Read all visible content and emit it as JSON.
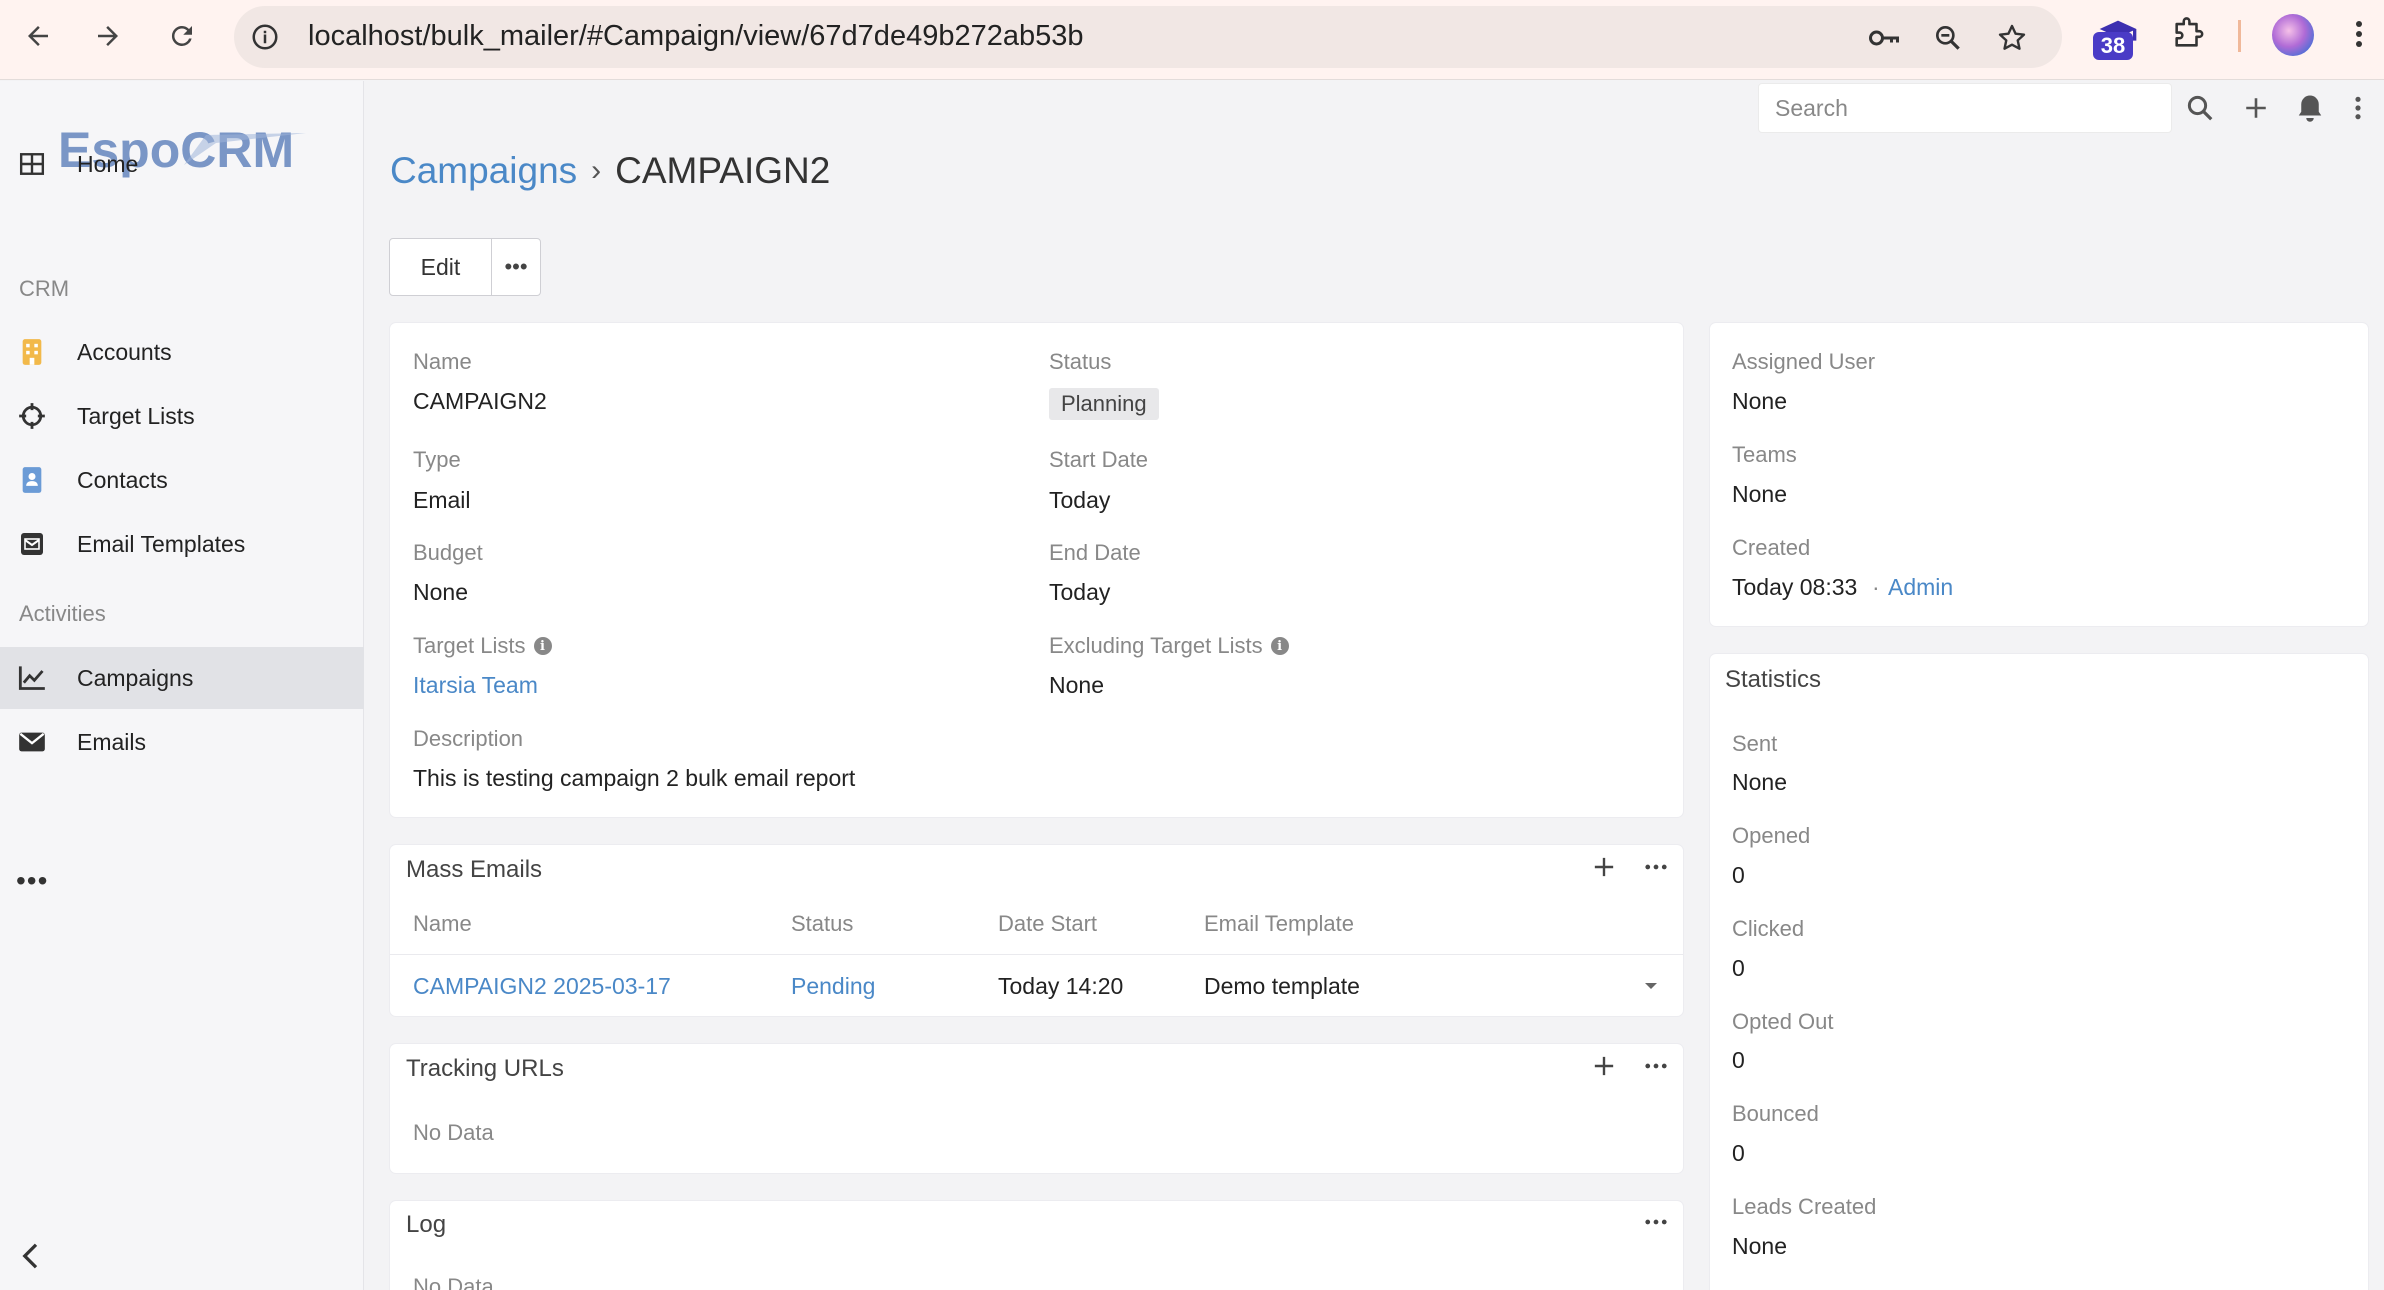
{
  "browser": {
    "url": "localhost/bulk_mailer/#Campaign/view/67d7de49b272ab53b",
    "extension_badge": "38"
  },
  "sidebar": {
    "logo_text": "EspoCRM",
    "home": "Home",
    "group_crm": "CRM",
    "accounts": "Accounts",
    "target_lists": "Target Lists",
    "contacts": "Contacts",
    "email_templates": "Email Templates",
    "group_activities": "Activities",
    "campaigns": "Campaigns",
    "emails": "Emails",
    "more": "•••"
  },
  "header": {
    "search_placeholder": "Search"
  },
  "breadcrumb": {
    "parent": "Campaigns",
    "separator": "›",
    "current": "CAMPAIGN2"
  },
  "actions": {
    "edit": "Edit",
    "more": "•••"
  },
  "detail": {
    "name_label": "Name",
    "name_value": "CAMPAIGN2",
    "status_label": "Status",
    "status_value": "Planning",
    "type_label": "Type",
    "type_value": "Email",
    "start_date_label": "Start Date",
    "start_date_value": "Today",
    "budget_label": "Budget",
    "budget_value": "None",
    "end_date_label": "End Date",
    "end_date_value": "Today",
    "target_lists_label": "Target Lists",
    "target_lists_value": "Itarsia Team",
    "excluding_label": "Excluding Target Lists",
    "excluding_value": "None",
    "description_label": "Description",
    "description_value": "This is testing campaign 2 bulk email report"
  },
  "side_panel": {
    "assigned_user_label": "Assigned User",
    "assigned_user_value": "None",
    "teams_label": "Teams",
    "teams_value": "None",
    "created_label": "Created",
    "created_value": "Today 08:33",
    "created_dot": "·",
    "created_by": "Admin"
  },
  "statistics": {
    "title": "Statistics",
    "sent_label": "Sent",
    "sent_value": "None",
    "opened_label": "Opened",
    "opened_value": "0",
    "clicked_label": "Clicked",
    "clicked_value": "0",
    "opted_out_label": "Opted Out",
    "opted_out_value": "0",
    "bounced_label": "Bounced",
    "bounced_value": "0",
    "leads_created_label": "Leads Created",
    "leads_created_value": "None"
  },
  "mass_emails": {
    "title": "Mass Emails",
    "columns": [
      "Name",
      "Status",
      "Date Start",
      "Email Template"
    ],
    "rows": [
      {
        "name": "CAMPAIGN2 2025-03-17",
        "status": "Pending",
        "date_start": "Today 14:20",
        "email_template": "Demo template"
      }
    ]
  },
  "tracking_urls": {
    "title": "Tracking URLs",
    "empty": "No Data"
  },
  "log": {
    "title": "Log",
    "empty": "No Data"
  },
  "colors": {
    "link": "#4a88c7",
    "sidebar_active": "#e1e2e6",
    "accounts_icon": "#f2b94a",
    "contacts_icon": "#6b9bd6"
  }
}
